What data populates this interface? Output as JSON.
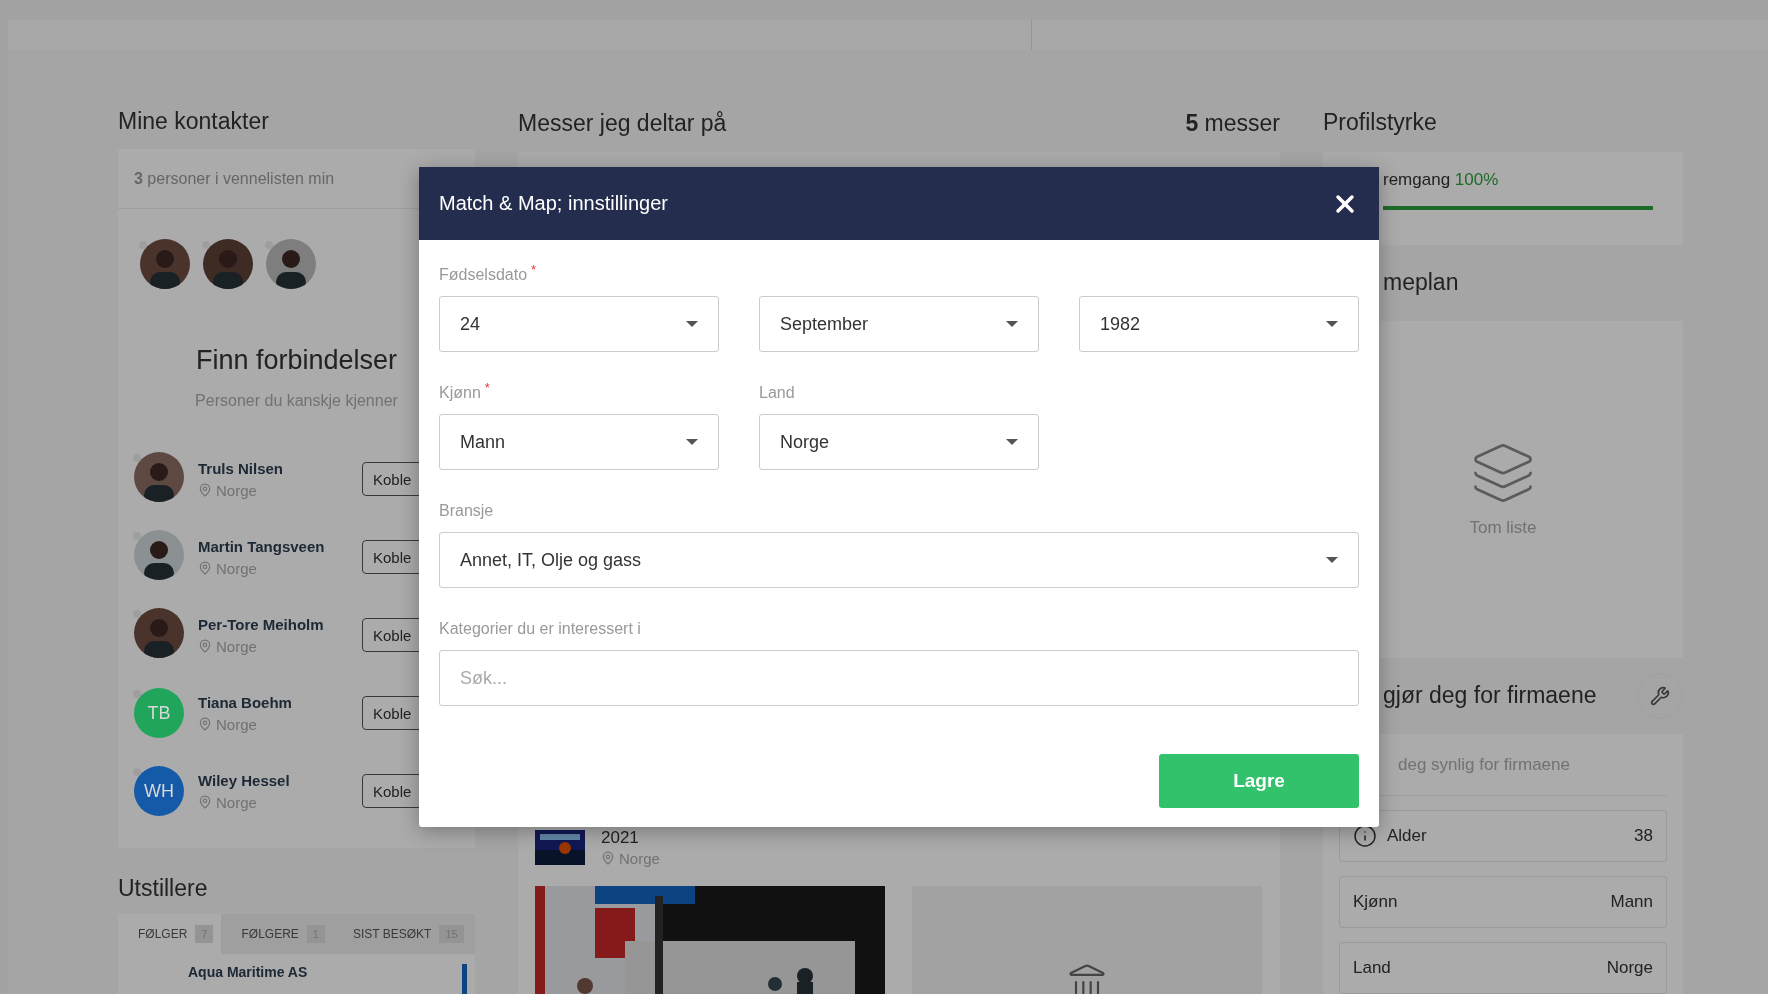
{
  "contacts": {
    "title": "Mine kontakter",
    "summary_count": "3",
    "summary_text": "personer i vennelisten min",
    "suggest_title": "Finn forbindelser",
    "suggest_subtitle": "Personer du kanskje kjenner",
    "people": [
      {
        "name": "Truls Nilsen",
        "location": "Norge",
        "button": "Koble"
      },
      {
        "name": "Martin Tangsveen",
        "location": "Norge",
        "button": "Koble"
      },
      {
        "name": "Per-Tore Meiholm",
        "location": "Norge",
        "button": "Koble"
      },
      {
        "name": "Tiana Boehm",
        "location": "Norge",
        "button": "Koble",
        "avatar": {
          "kind": "initials",
          "initials": "TB",
          "color": "#21a55a"
        }
      },
      {
        "name": "Wiley Hessel",
        "location": "Norge",
        "button": "Koble",
        "avatar": {
          "kind": "initials",
          "initials": "WH",
          "color": "#145aa8"
        }
      }
    ]
  },
  "exhibitors": {
    "title": "Utstillere",
    "tabs": [
      {
        "label": "FØLGER",
        "count": "7",
        "selected": true
      },
      {
        "label": "FØLGERE",
        "count": "1",
        "selected": false
      },
      {
        "label": "SIST BESØKT",
        "count": "15",
        "selected": false
      }
    ],
    "items": [
      {
        "name": "Aqua Maritime AS"
      }
    ]
  },
  "fairs": {
    "title": "Messer jeg deltar på",
    "count": "**5** messer",
    "item": {
      "year": "2021",
      "location": "Norge"
    }
  },
  "profile": {
    "title": "Profilstyrke",
    "progress_label": "remgang",
    "progress_value": "100%",
    "level": 1,
    "plan_title": "meplan",
    "plan_empty": "Tom liste",
    "visible_title": "gjør deg for firmaene",
    "visible_text": "deg synlig for firmaene",
    "rows": [
      {
        "label": "Alder",
        "value": "38",
        "info": true
      },
      {
        "label": "Kjønn",
        "value": "Mann",
        "info": false
      },
      {
        "label": "Land",
        "value": "Norge",
        "info": false
      }
    ]
  },
  "modal": {
    "title": "Match & Map; innstillinger",
    "rows": [
      {
        "kind": "triple",
        "groups": [
          {
            "label": "Fødselsdato",
            "required_mark": "*",
            "controls": [
              {
                "kind": "select",
                "value": "24"
              },
              {
                "kind": "select",
                "value": "September"
              },
              {
                "kind": "select",
                "value": "1982"
              }
            ]
          }
        ]
      },
      {
        "kind": "pair",
        "groups": [
          {
            "label": "Kjønn",
            "required_mark": "*",
            "controls": [
              {
                "kind": "select",
                "value": "Mann"
              }
            ]
          },
          {
            "label": "Land",
            "controls": [
              {
                "kind": "select",
                "value": "Norge"
              }
            ]
          }
        ]
      },
      {
        "kind": "full",
        "groups": [
          {
            "label": "Bransje",
            "controls": [
              {
                "kind": "select",
                "value": "Annet, IT, Olje og gass"
              }
            ]
          }
        ]
      },
      {
        "kind": "full",
        "groups": [
          {
            "label": "Kategorier du er interessert i",
            "controls": [
              {
                "kind": "search",
                "placeholder": "Søk..."
              }
            ]
          }
        ]
      }
    ],
    "save": "Lagre"
  }
}
